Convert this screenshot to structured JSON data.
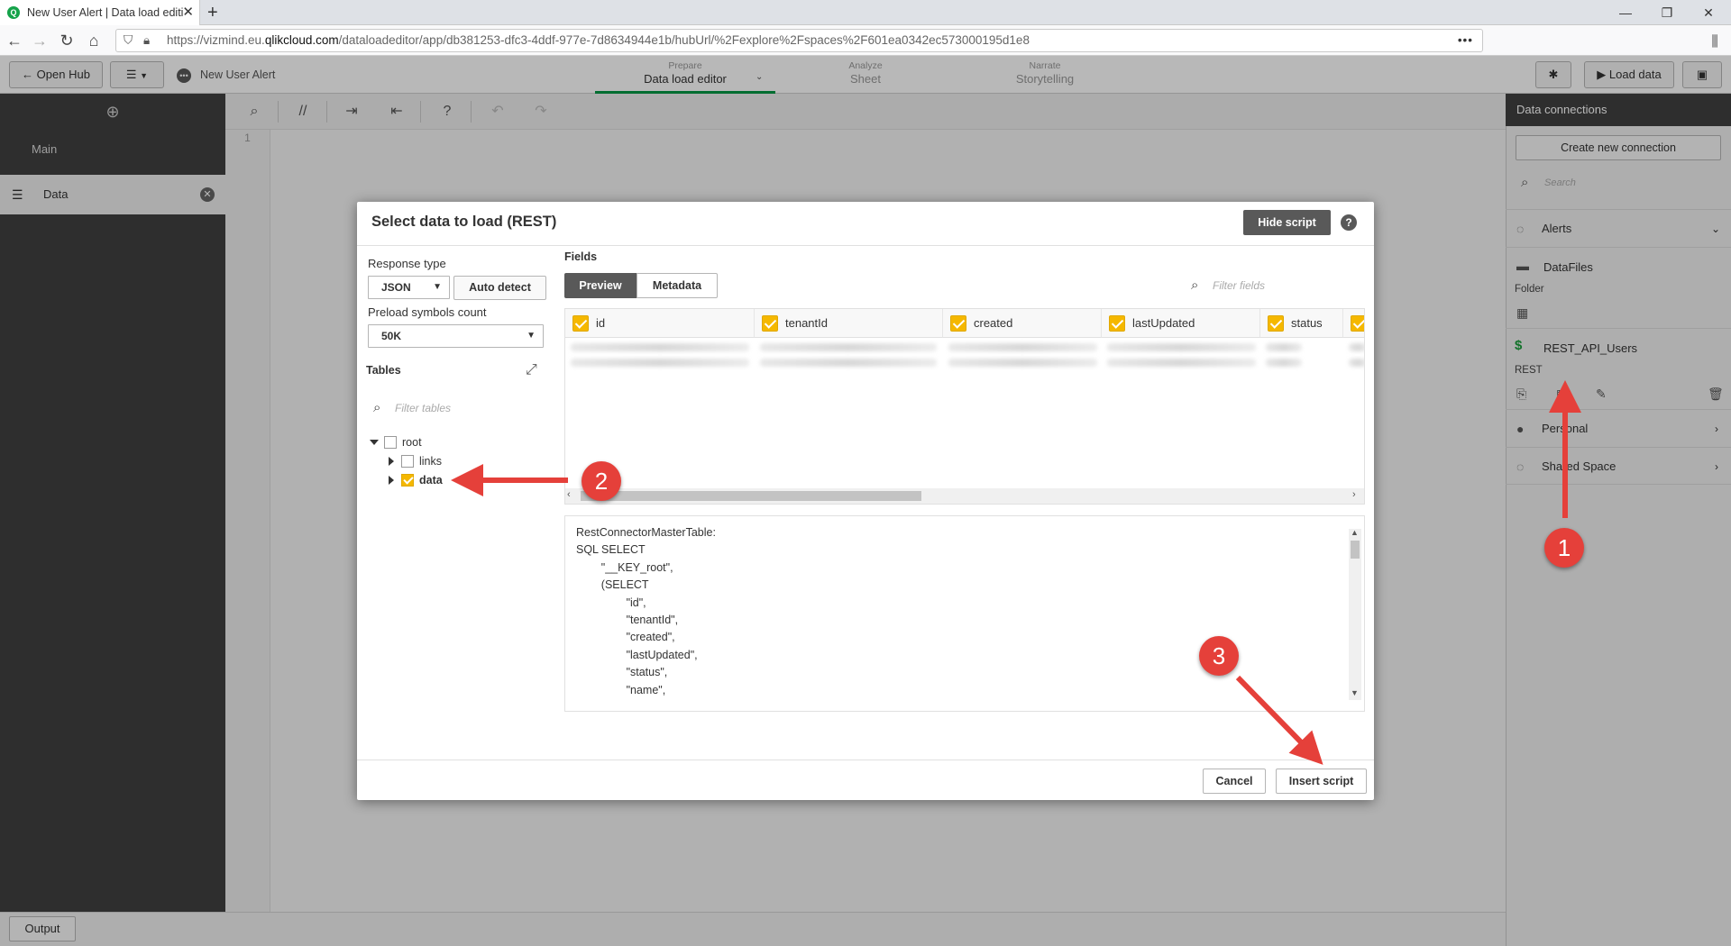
{
  "browser": {
    "tab_title": "New User Alert | Data load editi",
    "url_prefix": "https://vizmind.eu.",
    "url_domain": "qlikcloud.com",
    "url_rest": "/dataloadeditor/app/db381253-dfc3-4ddf-977e-7d8634944e1b/hubUrl/%2Fexplore%2Fspaces%2F601ea0342ec573000195d1e8",
    "new_tab": "+",
    "more": "•••"
  },
  "toolbar": {
    "open_hub": "Open Hub",
    "app_name": "New User Alert",
    "modes": [
      {
        "sub": "Prepare",
        "label": "Data load editor"
      },
      {
        "sub": "Analyze",
        "label": "Sheet"
      },
      {
        "sub": "Narrate",
        "label": "Storytelling"
      }
    ],
    "load_data": "Load data"
  },
  "left_panel": {
    "main": "Main",
    "data": "Data"
  },
  "editor": {
    "line_number": "1",
    "output": "Output"
  },
  "right_panel": {
    "title": "Data connections",
    "create": "Create new connection",
    "search_placeholder": "Search",
    "alerts": "Alerts",
    "datafiles": "DataFiles",
    "folder": "Folder",
    "rest_name": "REST_API_Users",
    "rest_type": "REST",
    "personal": "Personal",
    "shared": "Shared Space"
  },
  "dialog": {
    "title": "Select data to load (REST)",
    "hide_script": "Hide script",
    "response_type_label": "Response type",
    "response_type": "JSON",
    "auto_detect": "Auto detect",
    "preload_label": "Preload symbols count",
    "preload_value": "50K",
    "tables_label": "Tables",
    "filter_tables": "Filter tables",
    "tree": [
      {
        "label": "root",
        "checked": false
      },
      {
        "label": "links",
        "checked": false
      },
      {
        "label": "data",
        "checked": true
      }
    ],
    "fields_label": "Fields",
    "tab_preview": "Preview",
    "tab_metadata": "Metadata",
    "filter_fields": "Filter fields",
    "columns": [
      "id",
      "tenantId",
      "created",
      "lastUpdated",
      "status"
    ],
    "script_lines": [
      "RestConnectorMasterTable:",
      "SQL SELECT",
      "        \"__KEY_root\",",
      "        (SELECT",
      "                \"id\",",
      "                \"tenantId\",",
      "                \"created\",",
      "                \"lastUpdated\",",
      "                \"status\",",
      "                \"name\","
    ],
    "cancel": "Cancel",
    "insert": "Insert script"
  },
  "annotations": {
    "badge1": "1",
    "badge2": "2",
    "badge3": "3",
    "color": "#e5403a"
  }
}
